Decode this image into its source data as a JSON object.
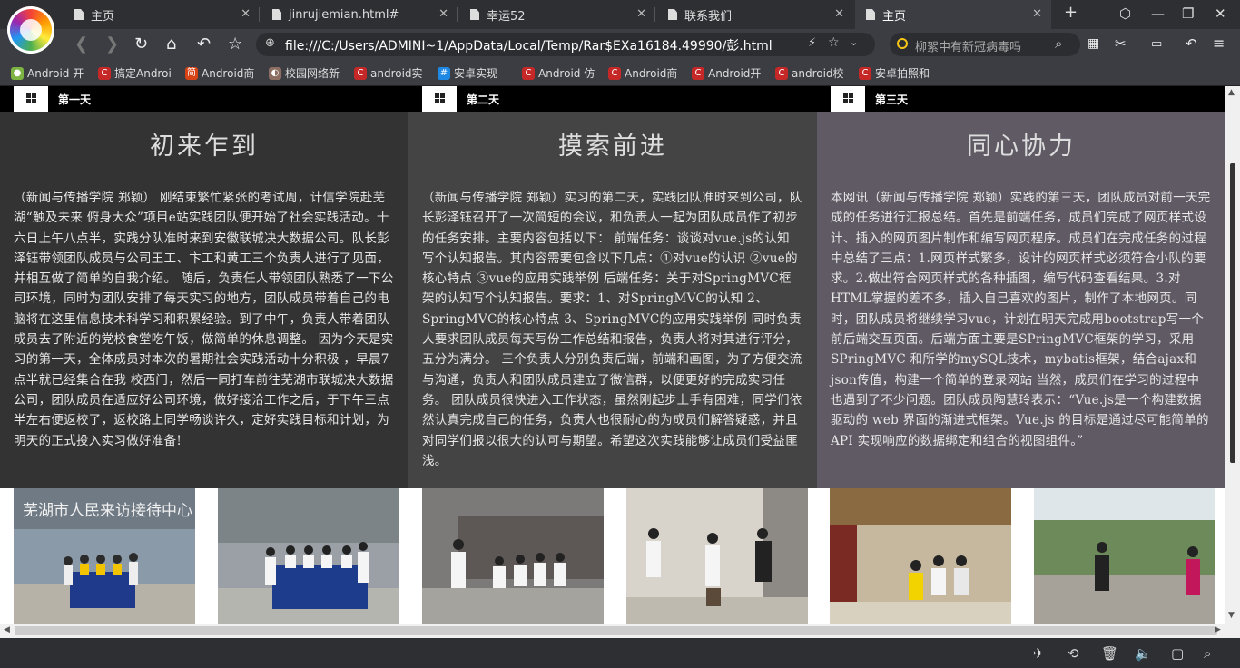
{
  "tabs": [
    {
      "label": "主页"
    },
    {
      "label": "jinrujiemian.html#"
    },
    {
      "label": "幸运52"
    },
    {
      "label": "联系我们"
    },
    {
      "label": "主页"
    }
  ],
  "address": {
    "url": "file:///C:/Users/ADMINI~1/AppData/Local/Temp/Rar$EXa16184.49990/彭.html"
  },
  "search": {
    "placeholder": "柳絮中有新冠病毒吗"
  },
  "bookmarks": [
    {
      "label": "Android 开"
    },
    {
      "label": "搞定Androi"
    },
    {
      "label": "Android商"
    },
    {
      "label": "校园网络新"
    },
    {
      "label": "android实"
    },
    {
      "label": "安卓实现"
    },
    {
      "label": "Android 仿"
    },
    {
      "label": "Android商"
    },
    {
      "label": "Android开"
    },
    {
      "label": "android校"
    },
    {
      "label": "安卓拍照和"
    }
  ],
  "columns": [
    {
      "day": "第一天",
      "title": "初来乍到",
      "text": "（新闻与传播学院 郑颖） 刚结束繁忙紧张的考试周，计信学院赴芜湖“触及未来 俯身大众”项目e站实践团队便开始了社会实践活动。十六日上午八点半，实践分队准时来到安徽联城决大数据公司。队长彭泽钰带领团队成员与公司王工、卞工和黄工三个负责人进行了见面，并相互做了简单的自我介绍。 随后，负责任人带领团队熟悉了一下公司环境，同时为团队安排了每天实习的地方，团队成员带着自己的电脑将在这里信息技术科学习和积累经验。到了中午，负责人带着团队成员去了附近的党校食堂吃午饭，做简单的休息调整。 因为今天是实习的第一天，全体成员对本次的暑期社会实践活动十分积极 ，早晨7点半就已经集合在我 校西门，然后一同打车前往芜湖市联城决大数据公司，团队成员在适应好公司环境，做好接洽工作之后，于下午三点半左右便返校了，返校路上同学畅谈许久，定好实践目标和计划，为明天的正式投入实习做好准备!"
    },
    {
      "day": "第二天",
      "title": "摸索前进",
      "text": "（新闻与传播学院 郑颖）实习的第二天，实践团队准时来到公司，队长彭泽钰召开了一次简短的会议，和负责人一起为团队成员作了初步的任务安排。主要内容包括以下： 前端任务：谈谈对vue.js的认知 写个认知报告。其内容需要包含以下几点：①对vue的认识 ②vue的核心特点 ③vue的应用实践举例 后端任务：关于对SpringMVC框架的认知写个认知报告。要求：1、对SpringMVC的认知 2、SpringMVC的核心特点 3、SpringMVC的应用实践举例 同时负责人要求团队成员每天写份工作总结和报告，负责人将对其进行评分，五分为满分。 三个负责人分别负责后端，前端和画图，为了方便交流与沟通，负责人和团队成员建立了微信群，以便更好的完成实习任务。 团队成员很快进入工作状态，虽然刚起步上手有困难，同学们依然认真完成自己的任务，负责人也很耐心的为成员们解答疑惑，并且对同学们报以很大的认可与期望。希望这次实践能够让成员们受益匪浅。"
    },
    {
      "day": "第三天",
      "title": "同心协力",
      "text": "本网讯（新闻与传播学院 郑颖）实践的第三天，团队成员对前一天完成的任务进行汇报总结。首先是前端任务，成员们完成了网页样式设计、插入的网页图片制作和编写网页程序。成员们在完成任务的过程中总结了三点：1.网页样式繁多，设计的网页样式必须符合小队的要求。2.做出符合网页样式的各种插图，编写代码查看结果。3.对HTML掌握的差不多，插入自己喜欢的图片，制作了本地网页。同时，团队成员将继续学习vue，计划在明天完成用bootstrap写一个前后端交互页面。后端方面主要是SPringMVC框架的学习，采用SPringMVC 和所学的mySQL技术，mybatis框架，结合ajax和json传值，构建一个简单的登录网站 当然，成员们在学习的过程中也遇到了不少问题。团队成员陶慧玲表示：“Vue.js是一个构建数据驱动的 web 界面的渐进式框架。Vue.js 的目标是通过尽可能简单的 API 实现响应的数据绑定和组合的视图组件。”"
    }
  ],
  "photo1": {
    "sign": "芜湖市人民来访接待中心"
  },
  "colors": {
    "col1": "#333333",
    "col2": "#444444",
    "col3": "#605a65",
    "header": "#000000"
  }
}
